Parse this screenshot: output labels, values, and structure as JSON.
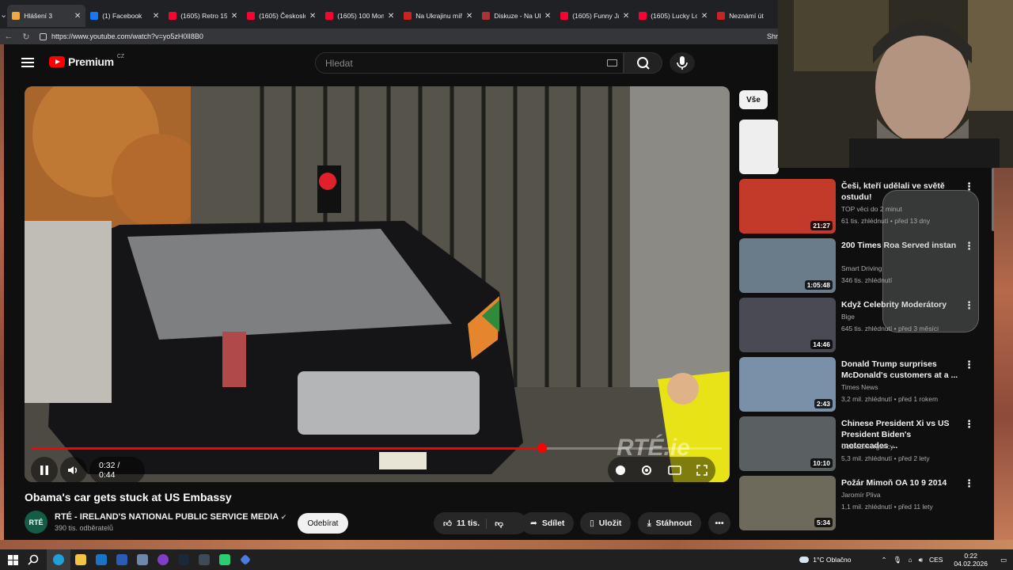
{
  "browser": {
    "tabs": [
      {
        "title": "Hlášení 3",
        "color": "#f2a93b",
        "active": true
      },
      {
        "title": "(1) Facebook",
        "color": "#1877f2",
        "active": false
      },
      {
        "title": "(1605) Retro 153",
        "color": "#ff0033",
        "active": false
      },
      {
        "title": "(1605) Českoslov",
        "color": "#ff0033",
        "active": false
      },
      {
        "title": "(1605) 100 Mome",
        "color": "#ff0033",
        "active": false
      },
      {
        "title": "Na Ukrajinu míří",
        "color": "#c22",
        "active": false
      },
      {
        "title": "Diskuze - Na Ukr",
        "color": "#a33",
        "active": false
      },
      {
        "title": "(1605) Funny Jap",
        "color": "#ff0033",
        "active": false
      },
      {
        "title": "(1605) Lucky Lou",
        "color": "#ff0033",
        "active": false
      },
      {
        "title": "Neznámí út",
        "color": "#c22",
        "active": false
      }
    ],
    "url": "https://www.youtube.com/watch?v=yo5zH0lI8B0",
    "right_label": "Shr"
  },
  "header": {
    "logo_text": "Premium",
    "country": "CZ",
    "search_placeholder": "Hledat"
  },
  "player": {
    "time": "0:32 / 0:44",
    "progress": 0.74,
    "watermark": "RTÉ.ie"
  },
  "video": {
    "title": "Obama's car gets stuck at US Embassy",
    "channel": "RTÉ - IRELAND'S NATIONAL PUBLIC SERVICE MEDIA",
    "avatar_text": "RTÉ",
    "subscribers": "390 tis. odběratelů",
    "subscribe_label": "Odebírat",
    "likes": "11 tis.",
    "share": "Sdílet",
    "save": "Uložit",
    "download": "Stáhnout"
  },
  "sidebar": {
    "chip": "Vše",
    "items": [
      {
        "title": "Češi, kteří udělali ve světě ostudu!",
        "channel": "TOP věci do 2 minut",
        "meta": "61 tis. zhlédnutí • před 13 dny",
        "duration": "21:27",
        "thumb": "#c43a2a"
      },
      {
        "title": "200 Times Roa Served instan",
        "channel": "Smart Driving",
        "meta": "346 tis. zhlédnutí",
        "duration": "1:05:48",
        "thumb": "#6a7b8a"
      },
      {
        "title": "Když Celebrity Moderátory",
        "channel": "Bige",
        "meta": "645 tis. zhlédnutí • před 3 měsíci",
        "duration": "14:46",
        "thumb": "#4a4a55"
      },
      {
        "title": "Donald Trump surprises McDonald's customers at a ...",
        "channel": "Times News",
        "meta": "3,2 mil. zhlédnutí • před 1 rokem",
        "duration": "2:43",
        "thumb": "#7a8fa8"
      },
      {
        "title": "Chinese President Xi vs US President Biden's motorcades ...",
        "channel": "CobraEmergency",
        "meta": "5,3 mil. zhlédnutí • před 2 lety",
        "duration": "10:10",
        "thumb": "#5a5f62"
      },
      {
        "title": "Požár Mimoň OA 10 9 2014",
        "channel": "Jaromír Pliva",
        "meta": "1,1 mil. zhlédnutí • před 11 lety",
        "duration": "5:34",
        "thumb": "#6d6a5c"
      }
    ]
  },
  "taskbar": {
    "weather": "1°C  Oblačno",
    "lang": "CES",
    "time": "0:22",
    "date": "04.02.2026"
  }
}
